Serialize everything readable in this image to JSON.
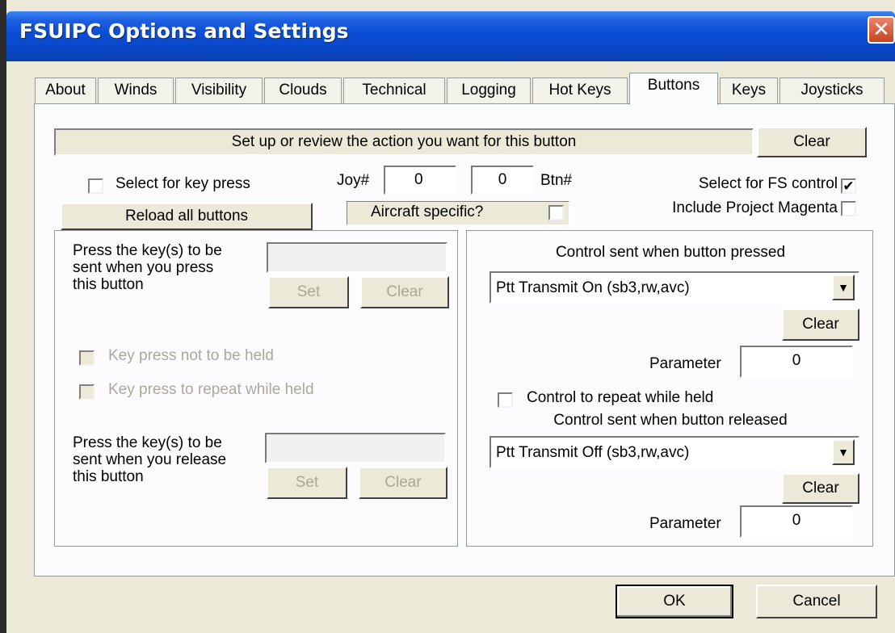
{
  "window": {
    "title": "FSUIPC Options and Settings",
    "close_symbol": "✕"
  },
  "tabs": [
    "About",
    "Winds",
    "Visibility",
    "Clouds",
    "Technical",
    "Logging",
    "Hot Keys",
    "Buttons",
    "Keys",
    "Joysticks"
  ],
  "active_tab": "Buttons",
  "header": {
    "status_text": "Set up or review the action you want for this button",
    "clear_label": "Clear"
  },
  "top": {
    "select_key_press_label": "Select for key press",
    "select_key_press_checked": false,
    "joy_label": "Joy#",
    "joy_value": "0",
    "btn_value": "0",
    "btn_label": "Btn#",
    "select_fs_control_label": "Select for FS control",
    "select_fs_control_checked": true,
    "include_pm_label": "Include Project Magenta",
    "include_pm_checked": false,
    "reload_label": "Reload all buttons",
    "aircraft_specific_label": "Aircraft specific?",
    "aircraft_specific_checked": false
  },
  "left_panel": {
    "press_text": "Press the key(s) to be sent when you press this button",
    "press_value": "",
    "set_label": "Set",
    "clear_label": "Clear",
    "not_held_label": "Key press not to be held",
    "repeat_label": "Key press to repeat while held",
    "release_text": "Press the key(s) to be sent when you release this button",
    "release_value": ""
  },
  "right_panel": {
    "pressed_heading": "Control sent when button pressed",
    "pressed_control": "Ptt Transmit On (sb3,rw,avc)",
    "clear_label": "Clear",
    "parameter_label": "Parameter",
    "pressed_param": "0",
    "repeat_label": "Control to repeat while held",
    "repeat_checked": false,
    "released_heading": "Control sent when button released",
    "released_control": "Ptt Transmit Off (sb3,rw,avc)",
    "released_param": "0"
  },
  "footer": {
    "ok_label": "OK",
    "cancel_label": "Cancel"
  }
}
